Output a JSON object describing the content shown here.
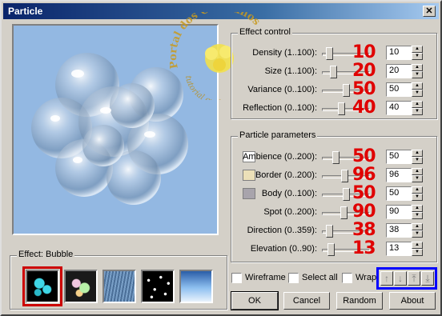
{
  "window": {
    "title": "Particle",
    "close_label": "✕"
  },
  "effect_control": {
    "label": "Effect control",
    "rows": [
      {
        "label": "Density (1..100):",
        "value": "10",
        "overlay": "10",
        "level": 0.1
      },
      {
        "label": "Size (1..100):",
        "value": "20",
        "overlay": "20",
        "level": 0.2
      },
      {
        "label": "Variance (0..100):",
        "value": "50",
        "overlay": "50",
        "level": 0.5
      },
      {
        "label": "Reflection (0..100):",
        "value": "40",
        "overlay": "40",
        "level": 0.4
      }
    ]
  },
  "particle_parameters": {
    "label": "Particle parameters",
    "rows": [
      {
        "label": "Ambience (0..200):",
        "value": "50",
        "overlay": "50",
        "level": 0.25,
        "swatch": "#ffffff"
      },
      {
        "label": "Border (0..200):",
        "value": "96",
        "overlay": "96",
        "level": 0.48,
        "swatch": "#ece0b8"
      },
      {
        "label": "Body (0..100):",
        "value": "50",
        "overlay": "50",
        "level": 0.5,
        "swatch": "#a8a4ac"
      },
      {
        "label": "Spot (0..200):",
        "value": "90",
        "overlay": "90",
        "level": 0.45
      },
      {
        "label": "Direction (0..359):",
        "value": "38",
        "overlay": "38",
        "level": 0.106
      },
      {
        "label": "Elevation (0..90):",
        "value": "13",
        "overlay": "13",
        "level": 0.144
      }
    ]
  },
  "effect": {
    "label": "Effect: Bubble"
  },
  "options": {
    "wireframe": "Wireframe",
    "select_all": "Select all",
    "wrap": "Wrap"
  },
  "buttons": {
    "ok": "OK",
    "cancel": "Cancel",
    "random": "Random",
    "about": "About"
  },
  "watermark": {
    "line1": "Portal dos Cantinhos",
    "line2": "tutorial exclusivo"
  },
  "colors": {
    "overlay_number": "#e00000",
    "highlight_box": "#0000ff",
    "selected_thumb": "#cc0000"
  }
}
